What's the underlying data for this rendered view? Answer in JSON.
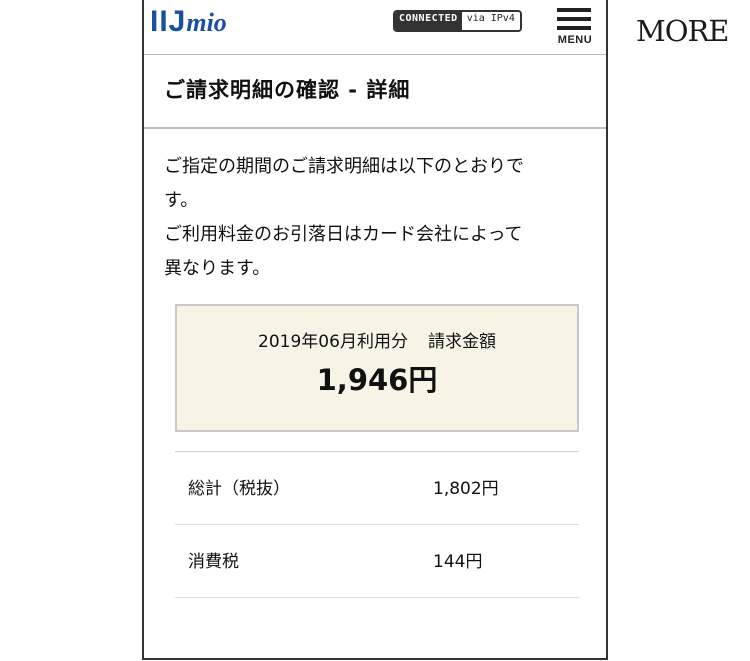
{
  "watermark": {
    "text": "MORE"
  },
  "header": {
    "logo_main": "IIJ",
    "logo_sub": "mio",
    "connection_status": "CONNECTED",
    "connection_via": "via IPv4",
    "menu_label": "MENU",
    "menu_icon": "hamburger-icon"
  },
  "page": {
    "title": "ご請求明細の確認 - 詳細",
    "description_lines": [
      "ご指定の期間のご請求明細は以下のとおりで",
      "す。",
      "ご利用料金のお引落日はカード会社によって",
      "異なります。"
    ]
  },
  "summary": {
    "period": "2019年06月利用分",
    "amount_label": "請求金額",
    "amount": "1,946円"
  },
  "breakdown": [
    {
      "label": "総計（税抜）",
      "value": "1,802円"
    },
    {
      "label": "消費税",
      "value": "144円"
    }
  ],
  "colors": {
    "brand": "#1a4fa3",
    "summary_bg": "#f7f4e6",
    "badge_dark": "#333333"
  }
}
